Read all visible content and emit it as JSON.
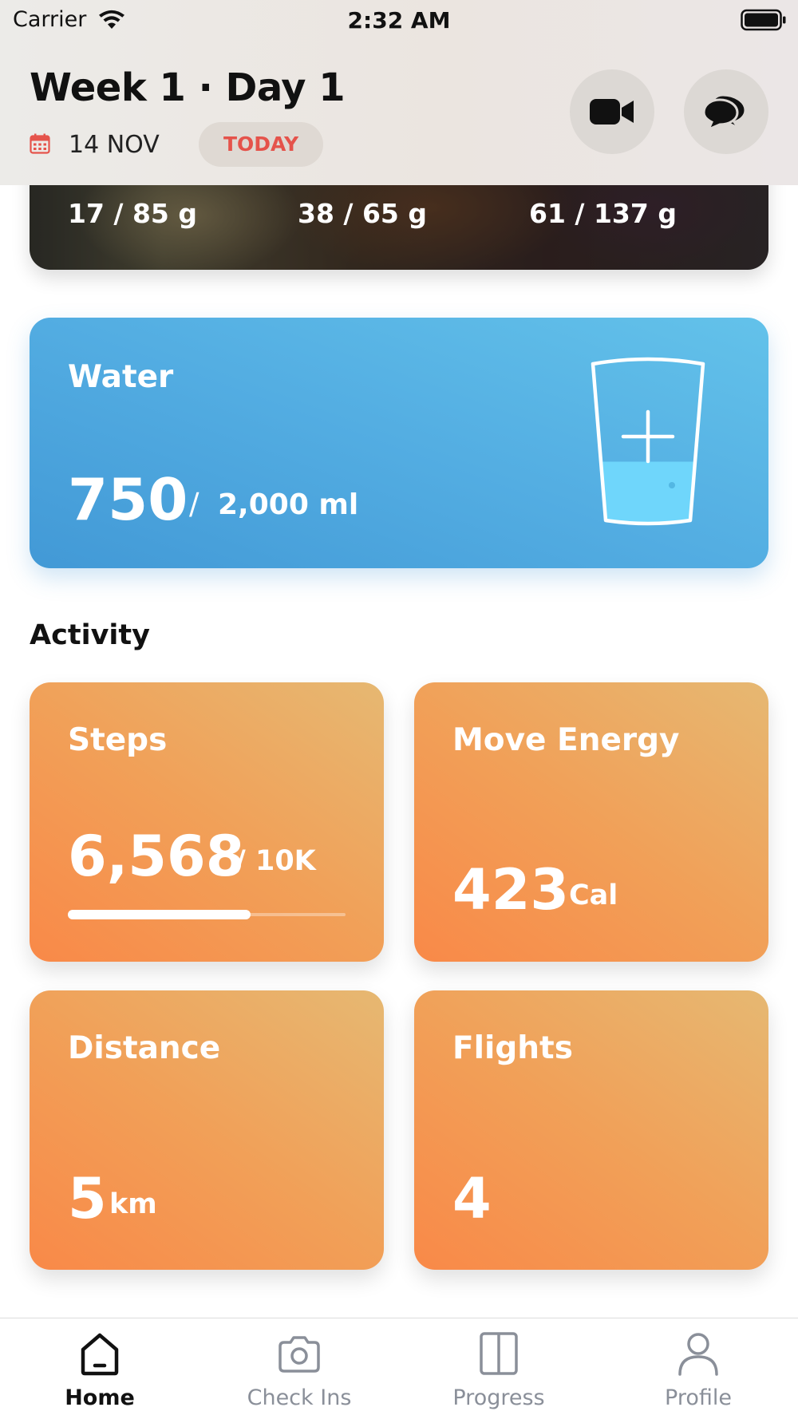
{
  "status_bar": {
    "carrier": "Carrier",
    "time": "2:32 AM"
  },
  "header": {
    "title": "Week 1 · Day 1",
    "date": "14 NOV",
    "today_label": "TODAY",
    "icons": [
      "calendar-icon",
      "video-camera-icon",
      "chat-bubbles-icon"
    ]
  },
  "food_macros": [
    {
      "current": "17",
      "rest": " / 85 g"
    },
    {
      "current": "38",
      "rest": " / 65 g"
    },
    {
      "current": "61",
      "rest": " / 137 g"
    }
  ],
  "water": {
    "title": "Water",
    "value": "750",
    "separator": "/",
    "goal": "2,000 ml",
    "fill_fraction": 0.375,
    "icon": "water-glass-plus-icon"
  },
  "activity": {
    "heading": "Activity",
    "steps": {
      "title": "Steps",
      "value": "6,568",
      "goal": "/ 10K",
      "progress": 0.6568
    },
    "move_energy": {
      "title": "Move Energy",
      "value": "423",
      "unit": "Cal"
    },
    "distance": {
      "title": "Distance",
      "value": "5",
      "unit": "km"
    },
    "flights": {
      "title": "Flights",
      "value": "4"
    }
  },
  "tabs": [
    {
      "label": "Home",
      "icon": "home-icon",
      "active": true
    },
    {
      "label": "Check Ins",
      "icon": "camera-icon",
      "active": false
    },
    {
      "label": "Progress",
      "icon": "progress-columns-icon",
      "active": false
    },
    {
      "label": "Profile",
      "icon": "person-icon",
      "active": false
    }
  ],
  "colors": {
    "accent_red": "#e5534b",
    "water_gradient_start": "#4299d6",
    "water_gradient_end": "#63c2ea",
    "activity_gradient_start": "#f98948",
    "activity_gradient_end": "#e6b872",
    "tab_inactive": "#8a8f99"
  }
}
